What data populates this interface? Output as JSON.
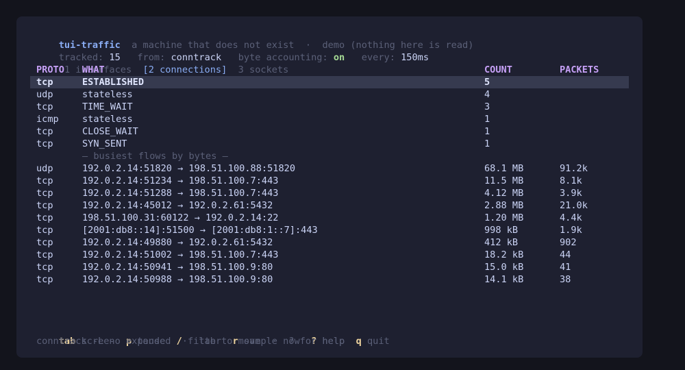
{
  "header": {
    "app": "tui-traffic",
    "tagline": "a machine that does not exist",
    "sep": "·",
    "mode": "demo (nothing here is read)"
  },
  "status": {
    "tracked_label": "tracked:",
    "tracked_value": "15",
    "from_label": "from:",
    "from_value": "conntrack",
    "byte_label": "byte accounting:",
    "byte_value": "on",
    "every_label": "every:",
    "every_value": "150ms"
  },
  "tabs": [
    "1 interfaces",
    "[2 connections]",
    "3 sockets"
  ],
  "table_headers": [
    "PROTO",
    "WHAT",
    "COUNT",
    "PACKETS"
  ],
  "states": [
    {
      "proto": "tcp",
      "what": "ESTABLISHED",
      "count": "5"
    },
    {
      "proto": "udp",
      "what": "stateless",
      "count": "4"
    },
    {
      "proto": "tcp",
      "what": "TIME_WAIT",
      "count": "3"
    },
    {
      "proto": "icmp",
      "what": "stateless",
      "count": "1"
    },
    {
      "proto": "tcp",
      "what": "CLOSE_WAIT",
      "count": "1"
    },
    {
      "proto": "tcp",
      "what": "SYN_SENT",
      "count": "1"
    }
  ],
  "flows_divider": "— busiest flows by bytes —",
  "flows": [
    {
      "proto": "udp",
      "what": "192.0.2.14:51820 → 198.51.100.88:51820",
      "bytes": "68.1 MB",
      "packets": "91.2k"
    },
    {
      "proto": "tcp",
      "what": "192.0.2.14:51234 → 198.51.100.7:443",
      "bytes": "11.5 MB",
      "packets": "8.1k"
    },
    {
      "proto": "tcp",
      "what": "192.0.2.14:51288 → 198.51.100.7:443",
      "bytes": "4.12 MB",
      "packets": "3.9k"
    },
    {
      "proto": "tcp",
      "what": "192.0.2.14:45012 → 192.0.2.61:5432",
      "bytes": "2.88 MB",
      "packets": "21.0k"
    },
    {
      "proto": "tcp",
      "what": "198.51.100.31:60122 → 192.0.2.14:22",
      "bytes": "1.20 MB",
      "packets": "4.4k"
    },
    {
      "proto": "tcp",
      "what": "[2001:db8::14]:51500 → [2001:db8:1::7]:443",
      "bytes": "998 kB",
      "packets": "1.9k"
    },
    {
      "proto": "tcp",
      "what": "192.0.2.14:49880 → 192.0.2.61:5432",
      "bytes": "412 kB",
      "packets": "902"
    },
    {
      "proto": "tcp",
      "what": "192.0.2.14:51002 → 198.51.100.7:443",
      "bytes": "18.2 kB",
      "packets": "44"
    },
    {
      "proto": "tcp",
      "what": "192.0.2.14:50941 → 198.51.100.9:80",
      "bytes": "15.0 kB",
      "packets": "41"
    },
    {
      "proto": "tcp",
      "what": "192.0.2.14:50988 → 198.51.100.9:80",
      "bytes": "14.1 kB",
      "packets": "38"
    }
  ],
  "keys": [
    {
      "key": "tab",
      "label": "screen"
    },
    {
      "key": "p",
      "label": "pause"
    },
    {
      "key": "/",
      "label": "filter"
    },
    {
      "key": "r",
      "label": "sample now"
    },
    {
      "key": "?",
      "label": "help"
    },
    {
      "key": "q",
      "label": "quit"
    }
  ],
  "footer_hint": "conntrack -L -o extended  ·  tab to move  ·  ? for help",
  "colors": {
    "background": "#13141c",
    "panel": "#1e2030",
    "accent": "#8aadf4",
    "header": "#c6a0f6",
    "key": "#eed49f",
    "on": "#a6da95",
    "selection": "#363a4f"
  }
}
